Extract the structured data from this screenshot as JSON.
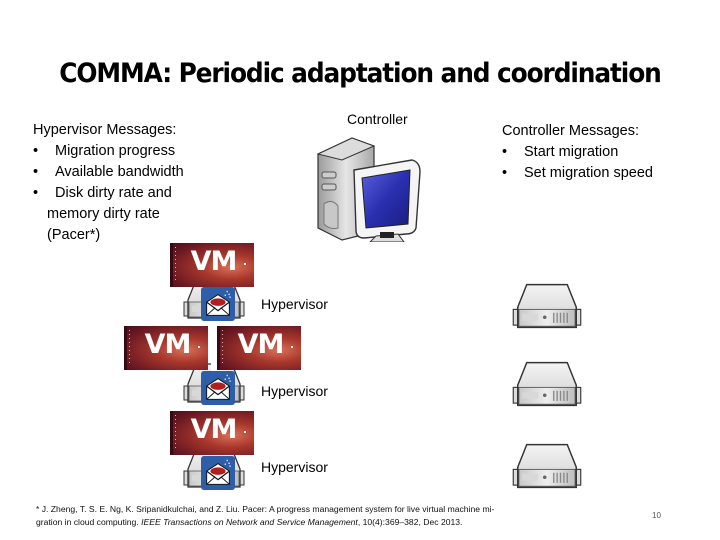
{
  "slide": {
    "title": "COMMA: Periodic adaptation and coordination",
    "page_number": "10"
  },
  "hypervisor_messages": {
    "heading": "Hypervisor Messages:",
    "items": [
      "Migration progress",
      "Available bandwidth",
      "Disk dirty rate and"
    ],
    "item3_continuation": [
      "memory  dirty rate",
      "(Pacer*)"
    ]
  },
  "controller_messages": {
    "heading": "Controller Messages:",
    "items": [
      "Start migration",
      "Set migration speed"
    ]
  },
  "diagram": {
    "controller_label": "Controller",
    "vm_label": "VM",
    "hypervisor_label": "Hypervisor",
    "colors": {
      "vm_background": "#8b2530",
      "mail_badge": "#2f5ea8",
      "monitor_screen": "#2a2fb0"
    }
  },
  "footnote": {
    "line1": "* J. Zheng, T. S. E. Ng, K. Sripanidkulchai, and Z. Liu. Pacer: A progress management system for live virtual machine mi-",
    "line2_prefix": "gration in cloud computing. ",
    "line2_italic": "IEEE Transactions on Network and Service Management",
    "line2_suffix": ", 10(4):369–382, Dec 2013."
  }
}
